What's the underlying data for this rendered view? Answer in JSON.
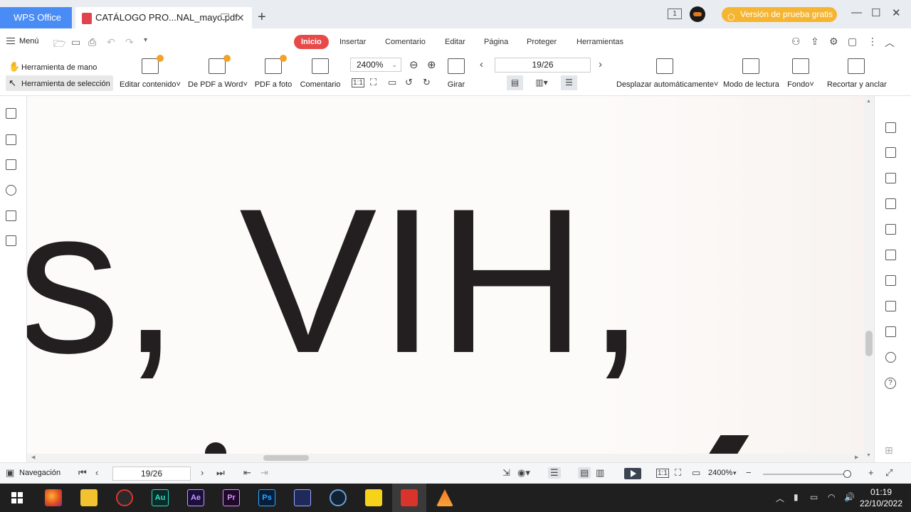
{
  "titlebar": {
    "home_tab": "WPS Office",
    "doc_tab": "CATÁLOGO PRO...NAL_mayo.pdf",
    "close_symbol": "✕",
    "add_symbol": "+",
    "page_badge": "1",
    "trial_label": "Versión de prueba gratis",
    "minimize_symbol": "—",
    "maximize_symbol": "☐",
    "close_window_symbol": "✕"
  },
  "menu": {
    "menu_label": "Menú",
    "tabs": [
      "Inicio",
      "Insertar",
      "Comentario",
      "Editar",
      "Página",
      "Proteger",
      "Herramientas"
    ],
    "active_tab": "Inicio"
  },
  "toolbar": {
    "hand_tool": "Herramienta de mano",
    "select_tool": "Herramienta de selección",
    "edit_content": "Editar contenido",
    "pdf_to_word": "De PDF a Word",
    "pdf_to_photo": "PDF a foto",
    "comment": "Comentario",
    "zoom": "2400%",
    "rotate": "Girar",
    "page": "19/26",
    "auto_scroll": "Desplazar automáticamente",
    "reading_mode": "Modo de lectura",
    "background": "Fondo",
    "crop_anchor": "Recortar y anclar",
    "dropdown_mark": "˅",
    "actual_size": "1:1"
  },
  "document": {
    "line1": "s, VIH,"
  },
  "statusbar": {
    "navigation": "Navegación",
    "page": "19/26",
    "zoom": "2400%",
    "actual_size": "1:1"
  },
  "taskbar": {
    "apps": [
      "Au",
      "Ae",
      "Pr",
      "Ps"
    ],
    "time": "01:19",
    "date": "22/10/2022"
  },
  "colors": {
    "wps_blue": "#4a8cf5",
    "active_tab_red": "#e84a4a",
    "trial_orange": "#f6b531",
    "text_dark": "#231f20"
  }
}
